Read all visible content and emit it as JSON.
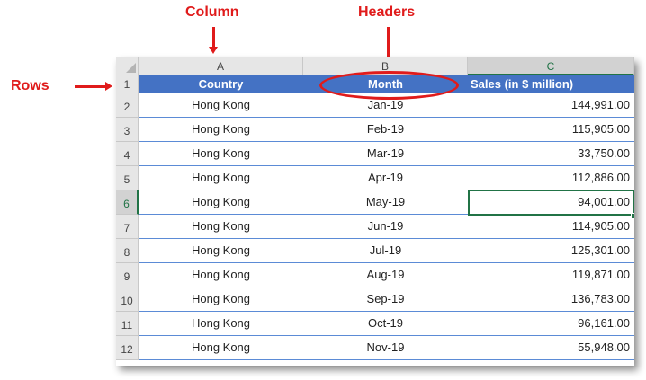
{
  "annotations": {
    "column_label": "Column",
    "headers_label": "Headers",
    "rows_label": "Rows",
    "color": "#e01b1b"
  },
  "sheet": {
    "columns": [
      "A",
      "B",
      "C"
    ],
    "row_numbers": [
      "1",
      "2",
      "3",
      "4",
      "5",
      "6",
      "7",
      "8",
      "9",
      "10",
      "11",
      "12"
    ],
    "selected_column": "C",
    "selected_row": "6",
    "header_fill": "#4472c4",
    "selection_color": "#217346",
    "headers": {
      "country": "Country",
      "month": "Month",
      "sales": "Sales (in $ million)"
    },
    "rows": [
      {
        "country": "Hong Kong",
        "month": "Jan-19",
        "sales": "144,991.00"
      },
      {
        "country": "Hong Kong",
        "month": "Feb-19",
        "sales": "115,905.00"
      },
      {
        "country": "Hong Kong",
        "month": "Mar-19",
        "sales": "33,750.00"
      },
      {
        "country": "Hong Kong",
        "month": "Apr-19",
        "sales": "112,886.00"
      },
      {
        "country": "Hong Kong",
        "month": "May-19",
        "sales": "94,001.00"
      },
      {
        "country": "Hong Kong",
        "month": "Jun-19",
        "sales": "114,905.00"
      },
      {
        "country": "Hong Kong",
        "month": "Jul-19",
        "sales": "125,301.00"
      },
      {
        "country": "Hong Kong",
        "month": "Aug-19",
        "sales": "119,871.00"
      },
      {
        "country": "Hong Kong",
        "month": "Sep-19",
        "sales": "136,783.00"
      },
      {
        "country": "Hong Kong",
        "month": "Oct-19",
        "sales": "96,161.00"
      },
      {
        "country": "Hong Kong",
        "month": "Nov-19",
        "sales": "55,948.00"
      }
    ]
  }
}
